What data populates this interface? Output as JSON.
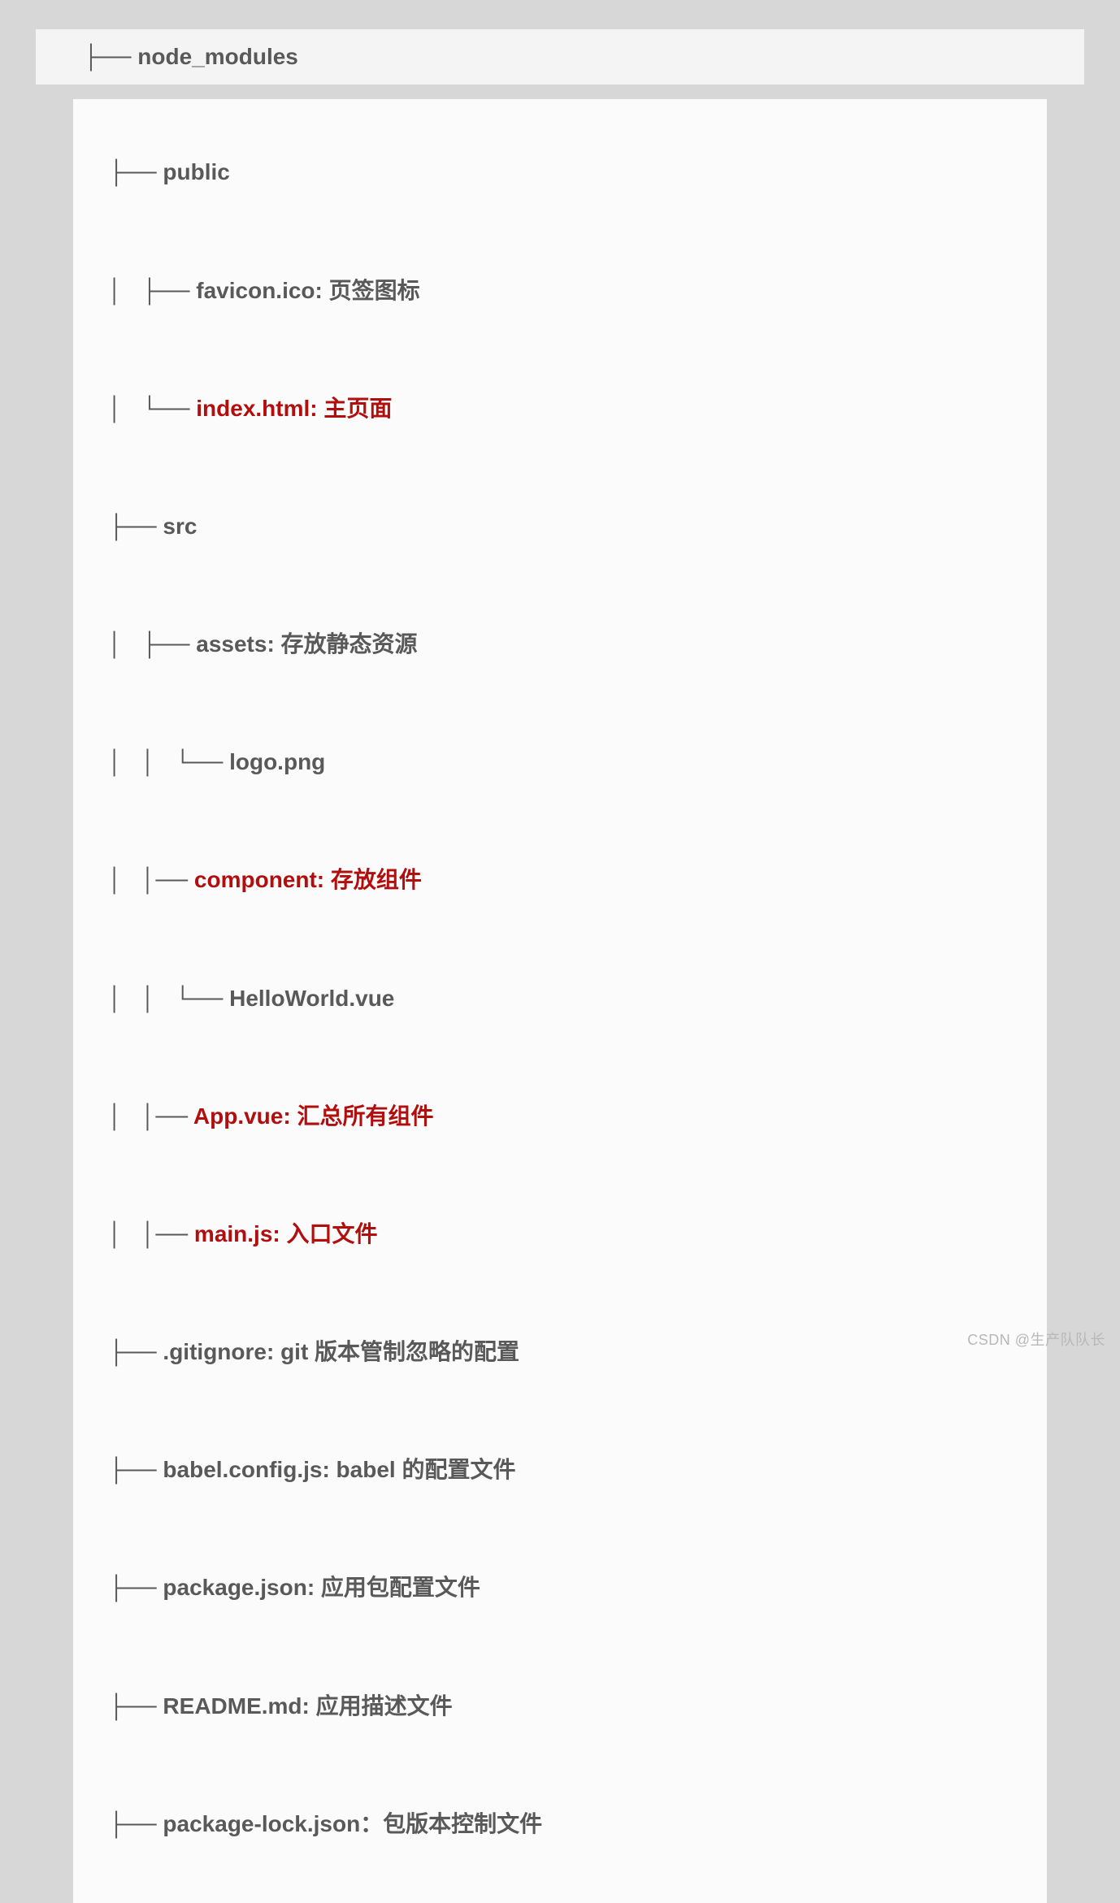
{
  "header": {
    "prefix": "├── ",
    "label": "node_modules"
  },
  "tree": [
    {
      "prefix": "├── ",
      "label": "public",
      "highlight": false
    },
    {
      "prefix": "│   ├── ",
      "label": "favicon.ico: 页签图标",
      "highlight": false
    },
    {
      "prefix": "│   └── ",
      "label": "index.html: 主页面",
      "highlight": true
    },
    {
      "prefix": "├── ",
      "label": "src",
      "highlight": false
    },
    {
      "prefix": "│   ├── ",
      "label": "assets: 存放静态资源",
      "highlight": false
    },
    {
      "prefix": "│   │   └── ",
      "label": "logo.png",
      "highlight": false
    },
    {
      "prefix": "│   │── ",
      "label": "component: 存放组件",
      "highlight": true
    },
    {
      "prefix": "│   │   └── ",
      "label": "HelloWorld.vue",
      "highlight": false
    },
    {
      "prefix": "│   │── ",
      "label": "App.vue: 汇总所有组件",
      "highlight": true
    },
    {
      "prefix": "│   │── ",
      "label": "main.js: 入口文件",
      "highlight": true
    },
    {
      "prefix": "├── ",
      "label": ".gitignore: git 版本管制忽略的配置",
      "highlight": false
    },
    {
      "prefix": "├── ",
      "label": "babel.config.js: babel 的配置文件",
      "highlight": false
    },
    {
      "prefix": "├── ",
      "label": "package.json: 应用包配置文件",
      "highlight": false
    },
    {
      "prefix": "├── ",
      "label": "README.md: 应用描述文件",
      "highlight": false
    },
    {
      "prefix": "├── ",
      "label": "package-lock.json：包版本控制文件",
      "highlight": false
    }
  ],
  "watermark": "CSDN @生产队队长"
}
